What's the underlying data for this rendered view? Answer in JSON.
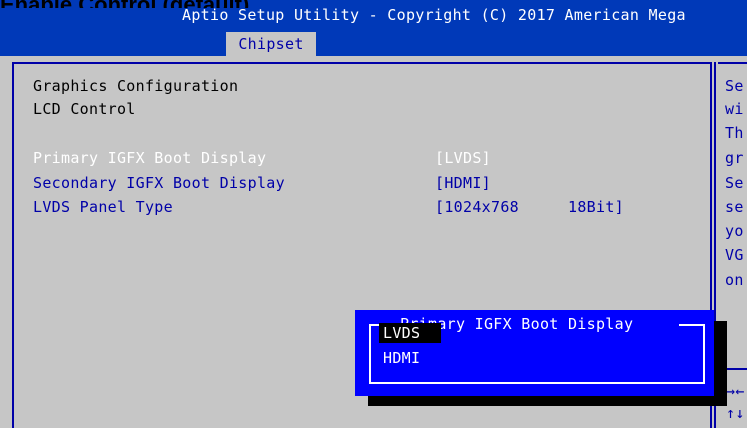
{
  "header": {
    "cut_text": "Enable Control (default)",
    "title": "Aptio Setup Utility - Copyright (C) 2017 American Mega",
    "active_tab": "Chipset"
  },
  "main": {
    "headings": [
      "Graphics Configuration",
      "LCD Control"
    ],
    "settings": [
      {
        "label": "Primary IGFX Boot Display",
        "value": "[LVDS]"
      },
      {
        "label": "Secondary IGFX Boot Display",
        "value": "[HDMI]"
      },
      {
        "label": "LVDS Panel Type",
        "value": "[1024x768",
        "value2": "18Bit]"
      }
    ]
  },
  "help": {
    "lines": [
      "Se",
      "wi",
      "Th",
      "gr",
      "Se",
      "se",
      "yo",
      "VG",
      "on"
    ],
    "keys": [
      "→←",
      "↑↓"
    ]
  },
  "popup": {
    "title": "Primary IGFX Boot Display",
    "options": [
      "LVDS",
      "HDMI"
    ],
    "selected": "LVDS"
  },
  "colors": {
    "header_bg": "#0039b8",
    "body_bg": "#c6c6c6",
    "accent_text": "#0000a8",
    "popup_bg": "#0000ff"
  }
}
